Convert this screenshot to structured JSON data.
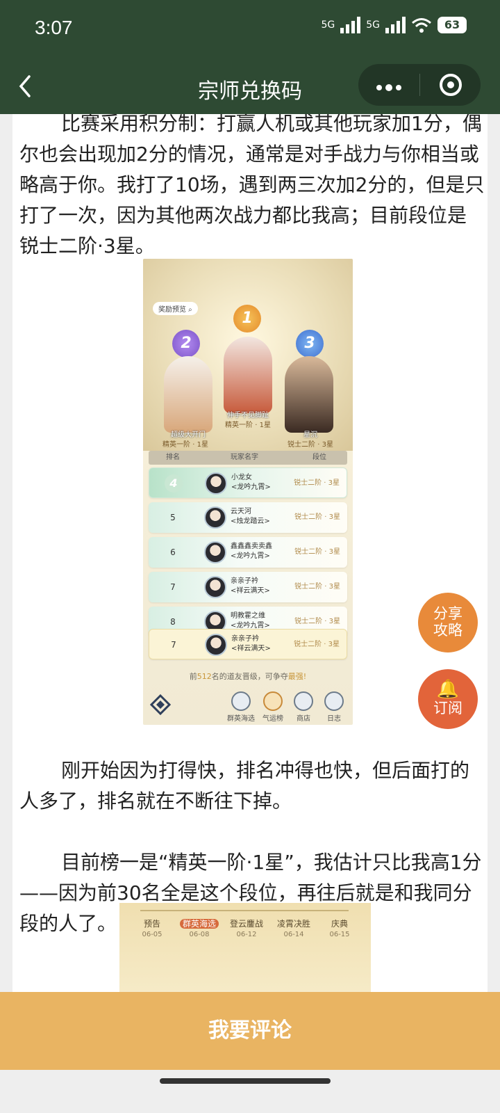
{
  "status": {
    "time": "3:07",
    "net1": "5G",
    "net2": "5G",
    "battery": "63"
  },
  "nav": {
    "back_icon": "chevron-left-icon",
    "title": "宗师兑换码",
    "more_icon": "more-dots-icon",
    "close_icon": "target-icon"
  },
  "article": {
    "para1": "比赛采用积分制：打赢人机或其他玩家加1分，偶尔也会出现加2分的情况，通常是对手战力与你相当或略高于你。我打了10场，遇到两三次加2分的，但是只打了一次，因为其他两次战力都比我高；目前段位是锐士二阶·3星。",
    "para2": "刚开始因为打得快，排名冲得也快，但后面打的人多了，排名就在不断往下掉。",
    "para3": "目前榜一是“精英一阶·1星”，我估计只比我高1分——因为前30名全是这个段位，再往后就是和我同分段的人了。"
  },
  "screenshot1": {
    "preview_label": "奖励预览",
    "podium": [
      {
        "rank": "1",
        "name": "伸手不见脚趾",
        "tier": "精英一阶 · 1星"
      },
      {
        "rank": "2",
        "name": "超级大开门",
        "tier": "精英一阶 · 1星"
      },
      {
        "rank": "3",
        "name": "星沉",
        "tier": "锐士二阶 · 3星"
      }
    ],
    "headers": [
      "排名",
      "玩家名字",
      "段位"
    ],
    "rows": [
      {
        "rank": "4",
        "name": "小龙女",
        "guild": "<龙吟九霄>",
        "tier": "锐士二阶 · 3星"
      },
      {
        "rank": "5",
        "name": "云天河",
        "guild": "<烛龙踏云>",
        "tier": "锐士二阶 · 3星"
      },
      {
        "rank": "6",
        "name": "鑫鑫鑫卖卖鑫",
        "guild": "<龙吟九霄>",
        "tier": "锐士二阶 · 3星"
      },
      {
        "rank": "7",
        "name": "亲亲子衿",
        "guild": "<祥云满天>",
        "tier": "锐士二阶 · 3星"
      },
      {
        "rank": "8",
        "name": "明教霍之维",
        "guild": "<龙吟九霄>",
        "tier": "锐士二阶 · 3星"
      },
      {
        "rank": "7",
        "name": "亲亲子衿",
        "guild": "<祥云满天>",
        "tier": "锐士二阶 · 3星"
      }
    ],
    "promo_pre": "前",
    "promo_num": "512",
    "promo_mid": "名的道友晋级，可争夺",
    "promo_end": "最强!",
    "bottom_nav": [
      "群英海选",
      "气运榜",
      "商店",
      "日志"
    ]
  },
  "screenshot2": {
    "stages": [
      {
        "name": "预告",
        "date": "06-05"
      },
      {
        "name": "群英海选",
        "date": "06-08"
      },
      {
        "name": "登云鏖战",
        "date": "06-12"
      },
      {
        "name": "凌霄决胜",
        "date": "06-14"
      },
      {
        "name": "庆典",
        "date": "06-15"
      }
    ]
  },
  "fab": {
    "share": "分享攻略",
    "share_l1": "分享",
    "share_l2": "攻略",
    "subscribe": "订阅",
    "subscribe_icon": "bell-icon"
  },
  "comment_button": "我要评论"
}
